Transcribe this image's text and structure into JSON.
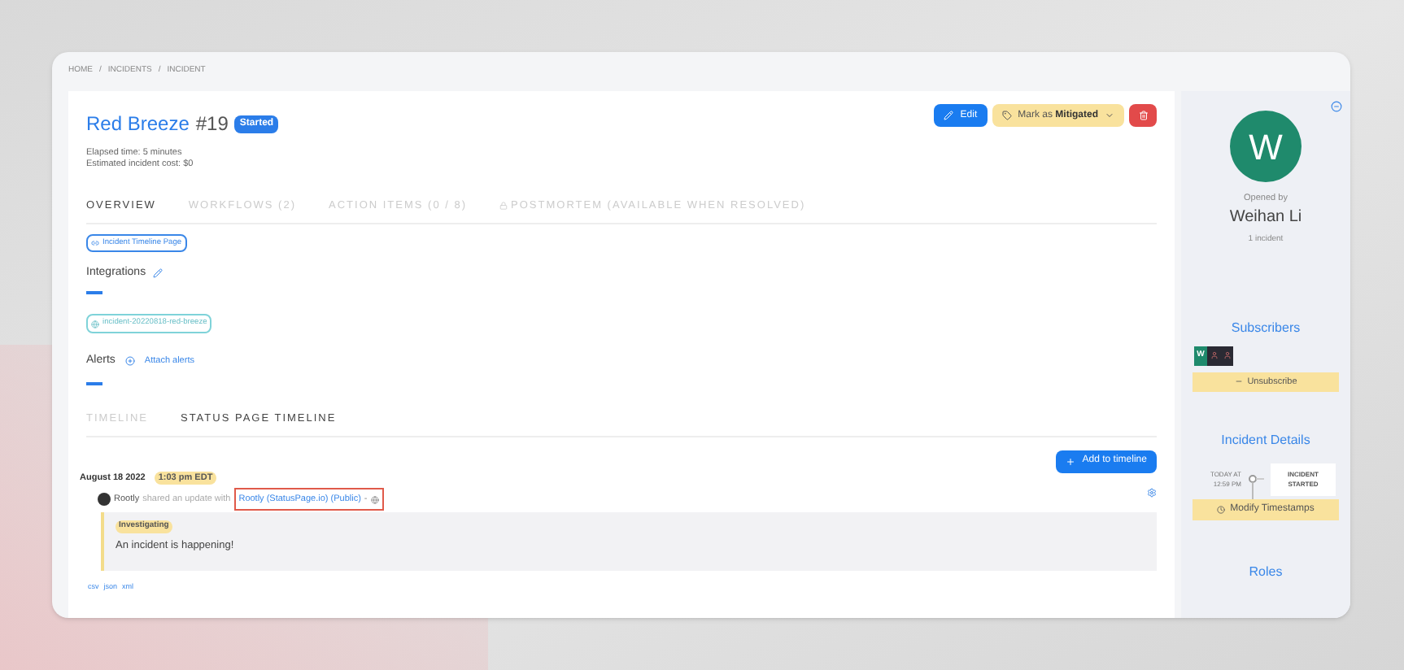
{
  "breadcrumb": {
    "separator": "/",
    "items": [
      "HOME",
      "INCIDENTS",
      "INCIDENT"
    ]
  },
  "incident": {
    "title": "Red Breeze",
    "number": "#19",
    "status": "Started",
    "elapsed": "Elapsed time: 5 minutes",
    "cost": "Estimated incident cost: $0"
  },
  "actions": {
    "edit": "Edit",
    "mark_prefix": "Mark as",
    "mark_value": "Mitigated"
  },
  "tabs": [
    {
      "label": "OVERVIEW",
      "selected": true,
      "locked": false
    },
    {
      "label": "WORKFLOWS (2)",
      "selected": false,
      "locked": false
    },
    {
      "label": "ACTION ITEMS (0 / 8)",
      "selected": false,
      "locked": false
    },
    {
      "label": "POSTMORTEM (AVAILABLE WHEN RESOLVED)",
      "selected": false,
      "locked": true
    }
  ],
  "timeline_page_chip": "Incident Timeline Page",
  "integrations": {
    "heading": "Integrations",
    "chip": "incident-20220818-red-breeze"
  },
  "alerts": {
    "heading": "Alerts",
    "link": "Attach alerts"
  },
  "timeline_tabs": [
    {
      "label": "TIMELINE",
      "selected": false
    },
    {
      "label": "STATUS PAGE TIMELINE",
      "selected": true
    }
  ],
  "add_button": "Add to timeline",
  "event": {
    "date": "August 18 2022",
    "time": "1:03 pm EDT",
    "author": "Rootly",
    "action": "shared an update with",
    "target": "Rootly (StatusPage.io) (Public)",
    "separator": "-",
    "status": "Investigating",
    "message": "An incident is happening!"
  },
  "exports": [
    "csv",
    "json",
    "xml"
  ],
  "sidebar": {
    "avatar_letter": "W",
    "opened_by": "Opened by",
    "name": "Weihan Li",
    "count": "1 incident",
    "subscribers_heading": "Subscribers",
    "subscribers": [
      {
        "kind": "letter",
        "letter": "W"
      },
      {
        "kind": "photo"
      },
      {
        "kind": "photo"
      }
    ],
    "unsubscribe": "Unsubscribe",
    "details_heading": "Incident Details",
    "event_time": "TODAY AT 12:59 PM",
    "event_label": "INCIDENT STARTED",
    "modify": "Modify Timestamps",
    "roles_heading": "Roles"
  }
}
